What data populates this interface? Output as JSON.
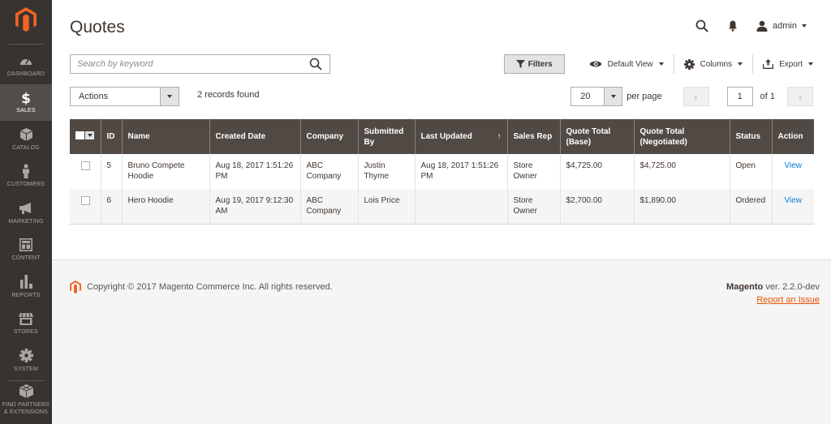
{
  "sidebar": {
    "logo": "magento-logo",
    "items": [
      {
        "id": "dashboard",
        "label": "Dashboard",
        "icon": "dashboard-icon",
        "active": false
      },
      {
        "id": "sales",
        "label": "Sales",
        "icon": "dollar-icon",
        "active": true
      },
      {
        "id": "catalog",
        "label": "Catalog",
        "icon": "box-icon",
        "active": false
      },
      {
        "id": "customers",
        "label": "Customers",
        "icon": "person-icon",
        "active": false
      },
      {
        "id": "marketing",
        "label": "Marketing",
        "icon": "megaphone-icon",
        "active": false
      },
      {
        "id": "content",
        "label": "Content",
        "icon": "layout-icon",
        "active": false
      },
      {
        "id": "reports",
        "label": "Reports",
        "icon": "bar-chart-icon",
        "active": false
      },
      {
        "id": "stores",
        "label": "Stores",
        "icon": "storefront-icon",
        "active": false
      },
      {
        "id": "system",
        "label": "System",
        "icon": "gear-icon",
        "active": false
      },
      {
        "id": "partners",
        "label": "Find Partners & Extensions",
        "icon": "blocks-icon",
        "active": false
      }
    ]
  },
  "header": {
    "title": "Quotes",
    "user": "admin"
  },
  "toolbar": {
    "search_placeholder": "Search by keyword",
    "search_value": "",
    "filters_label": "Filters",
    "view_label": "Default View",
    "columns_label": "Columns",
    "export_label": "Export",
    "actions_label": "Actions",
    "records_found": "2 records found",
    "per_page_value": "20",
    "per_page_label": "per page",
    "page_value": "1",
    "page_of": "of 1",
    "prev": "‹",
    "next": "›"
  },
  "table": {
    "columns": [
      {
        "id": "id",
        "label": "ID"
      },
      {
        "id": "name",
        "label": "Name"
      },
      {
        "id": "created",
        "label": "Created Date"
      },
      {
        "id": "company",
        "label": "Company"
      },
      {
        "id": "submitted_by",
        "label": "Submitted By"
      },
      {
        "id": "last_updated",
        "label": "Last Updated",
        "sort": "↑"
      },
      {
        "id": "sales_rep",
        "label": "Sales Rep"
      },
      {
        "id": "total_base",
        "label": "Quote Total (Base)"
      },
      {
        "id": "total_negotiated",
        "label": "Quote Total (Negotiated)"
      },
      {
        "id": "status",
        "label": "Status"
      },
      {
        "id": "action",
        "label": "Action"
      }
    ],
    "rows": [
      {
        "id": "5",
        "name": "Bruno Compete Hoodie",
        "created": "Aug 18, 2017 1:51:26 PM",
        "company": "ABC Company",
        "submitted_by": "Justin Thyme",
        "last_updated": "Aug 18, 2017 1:51:26 PM",
        "sales_rep": "Store Owner",
        "total_base": "$4,725.00",
        "total_negotiated": "$4,725.00",
        "status": "Open",
        "action": "View"
      },
      {
        "id": "6",
        "name": "Hero Hoodie",
        "created": "Aug 19, 2017 9:12:30 AM",
        "company": "ABC Company",
        "submitted_by": "Lois Price",
        "last_updated": "",
        "sales_rep": "Store Owner",
        "total_base": "$2,700.00",
        "total_negotiated": "$1,890.00",
        "status": "Ordered",
        "action": "View"
      }
    ]
  },
  "footer": {
    "copyright": "Copyright © 2017 Magento Commerce Inc. All rights reserved.",
    "brand": "Magento",
    "version": "ver. 2.2.0-dev",
    "report_link": "Report an Issue"
  },
  "colors": {
    "sidebar_bg": "#373330",
    "sidebar_active": "#524d49",
    "header_row": "#514943",
    "brand_orange": "#eb5202",
    "link_blue": "#007bdb"
  }
}
